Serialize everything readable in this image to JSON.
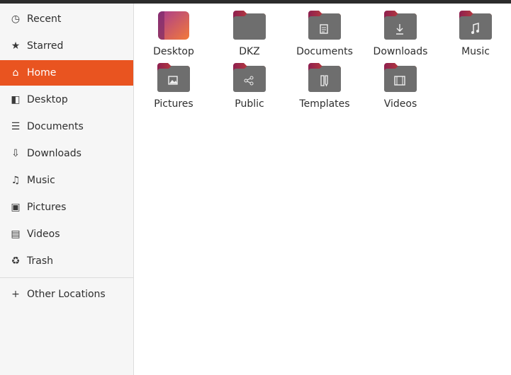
{
  "sidebar": {
    "items": [
      {
        "label": "Recent",
        "icon": "clock-icon"
      },
      {
        "label": "Starred",
        "icon": "star-icon"
      },
      {
        "label": "Home",
        "icon": "home-icon",
        "active": true
      },
      {
        "label": "Desktop",
        "icon": "desktop-icon"
      },
      {
        "label": "Documents",
        "icon": "document-icon"
      },
      {
        "label": "Downloads",
        "icon": "download-icon"
      },
      {
        "label": "Music",
        "icon": "music-icon"
      },
      {
        "label": "Pictures",
        "icon": "picture-icon"
      },
      {
        "label": "Videos",
        "icon": "video-icon"
      },
      {
        "label": "Trash",
        "icon": "trash-icon"
      }
    ],
    "other_locations": {
      "label": "Other Locations",
      "icon": "plus-icon"
    }
  },
  "folders": [
    {
      "label": "Desktop",
      "emblem": "desktop"
    },
    {
      "label": "DKZ",
      "emblem": "none"
    },
    {
      "label": "Documents",
      "emblem": "document"
    },
    {
      "label": "Downloads",
      "emblem": "download"
    },
    {
      "label": "Music",
      "emblem": "music"
    },
    {
      "label": "Pictures",
      "emblem": "picture"
    },
    {
      "label": "Public",
      "emblem": "share"
    },
    {
      "label": "Templates",
      "emblem": "template"
    },
    {
      "label": "Videos",
      "emblem": "video"
    }
  ],
  "colors": {
    "accent": "#e95420",
    "folder_body": "#6e6e6e",
    "folder_tab": "#a2234f"
  }
}
